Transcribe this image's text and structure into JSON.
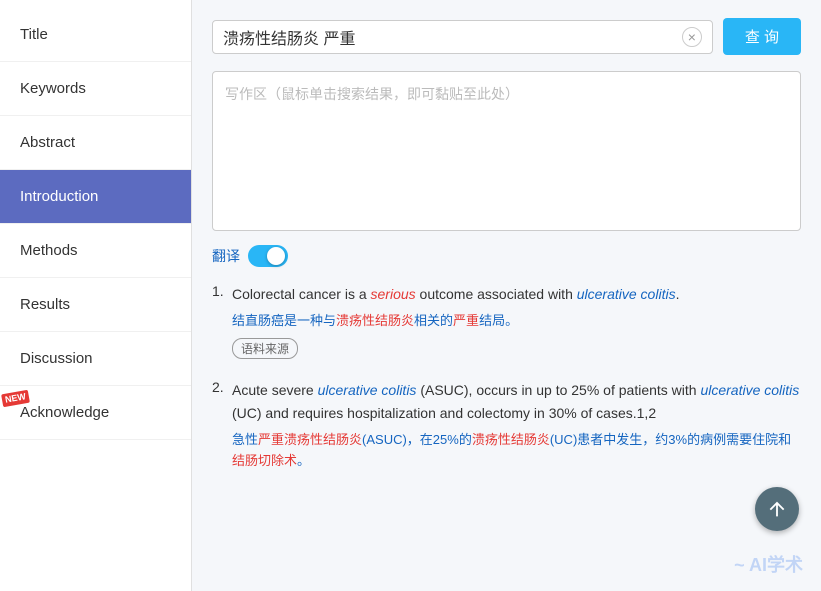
{
  "sidebar": {
    "items": [
      {
        "id": "title",
        "label": "Title",
        "active": false,
        "new": false
      },
      {
        "id": "keywords",
        "label": "Keywords",
        "active": false,
        "new": false
      },
      {
        "id": "abstract",
        "label": "Abstract",
        "active": false,
        "new": false
      },
      {
        "id": "introduction",
        "label": "Introduction",
        "active": true,
        "new": false
      },
      {
        "id": "methods",
        "label": "Methods",
        "active": false,
        "new": false
      },
      {
        "id": "results",
        "label": "Results",
        "active": false,
        "new": false
      },
      {
        "id": "discussion",
        "label": "Discussion",
        "active": false,
        "new": false
      },
      {
        "id": "acknowledge",
        "label": "Acknowledge",
        "active": false,
        "new": true
      }
    ]
  },
  "search": {
    "query": "溃疡性结肠炎 严重",
    "clear_btn": "×",
    "search_btn": "查 询",
    "placeholder": "写作区（鼠标单击搜索结果，即可黏贴至此处）"
  },
  "translate": {
    "label": "翻译"
  },
  "results": [
    {
      "number": "1.",
      "en_parts": [
        {
          "text": "Colorectal cancer is a ",
          "style": "normal"
        },
        {
          "text": "serious",
          "style": "italic-red"
        },
        {
          "text": " outcome associated with ",
          "style": "normal"
        },
        {
          "text": "ulcerative colitis",
          "style": "italic-blue"
        },
        {
          "text": ".",
          "style": "normal"
        }
      ],
      "cn": "结直肠癌是一种与溃疡性结肠炎相关的严重结局。",
      "cn_highlights": [
        {
          "text": "溃疡性结肠炎",
          "style": "red"
        },
        {
          "text": "严重",
          "style": "red"
        }
      ],
      "corpus_tag": "语料来源",
      "show_tag": true
    },
    {
      "number": "2.",
      "en_parts": [
        {
          "text": "Acute severe ",
          "style": "normal"
        },
        {
          "text": "ulcerative colitis",
          "style": "italic-blue"
        },
        {
          "text": " (ASUC), occurs in up to 25% of patients with ",
          "style": "normal"
        },
        {
          "text": "ulcerative colitis",
          "style": "italic-blue"
        },
        {
          "text": " (UC) and requires hospitalization and colectomy in 30% of cases.1,2",
          "style": "normal"
        }
      ],
      "cn": "急性严重溃疡性结肠炎(ASUC)，在25%的溃疡性结肠炎(UC)患者中发生，约3%的病例需要住院和结肠切除术。",
      "cn_highlights": [
        {
          "text": "急性严重溃疡性结肠炎",
          "style": "red"
        },
        {
          "text": "溃疡性结肠炎",
          "style": "red"
        },
        {
          "text": "结肠切除术",
          "style": "red"
        }
      ],
      "show_tag": false
    }
  ],
  "watermark": "~ AI学术"
}
